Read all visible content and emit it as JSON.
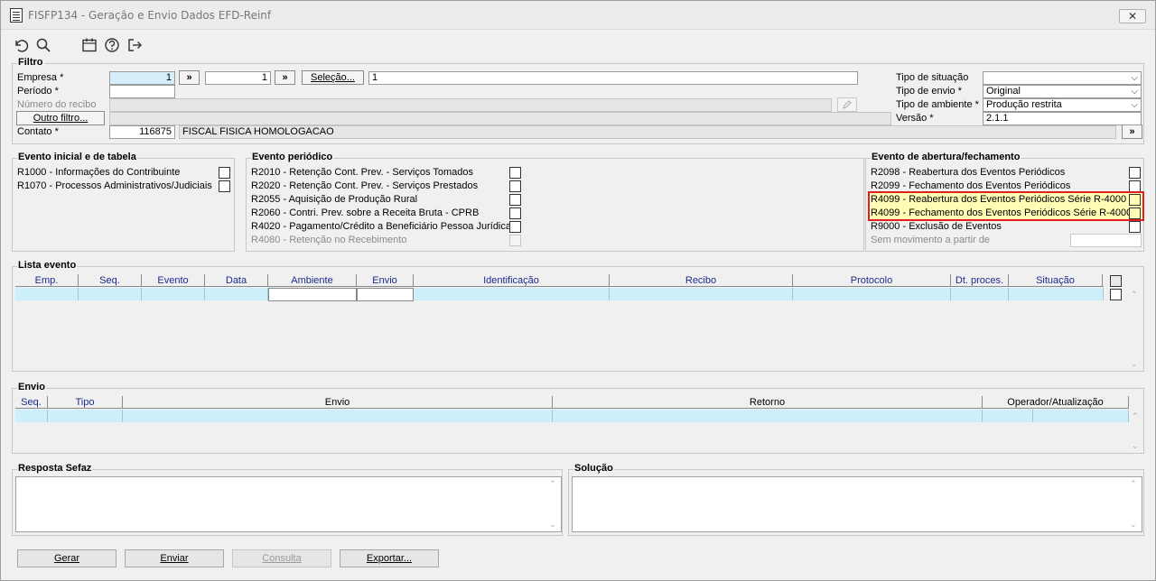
{
  "window": {
    "title": "FISFP134 - Geração e Envio Dados EFD-Reinf",
    "close": "✕"
  },
  "toolbar": {
    "icons": [
      "undo-icon",
      "search-icon",
      "calendar-icon",
      "help-icon",
      "exit-icon"
    ]
  },
  "filtro": {
    "title": "Filtro",
    "empresa_label": "Empresa *",
    "empresa_from": "1",
    "empresa_to": "1",
    "more_btn": "»",
    "selecao_btn": "Seleção...",
    "selecao_value": "1",
    "periodo_label": "Período *",
    "periodo_value": "",
    "recibo_label": "Número do recibo",
    "outro_btn": "Outro filtro...",
    "contato_label": "Contato *",
    "contato_code": "116875",
    "contato_name": "FISCAL FISICA HOMOLOGACAO",
    "tipo_situacao_label": "Tipo de situação",
    "tipo_situacao_value": "",
    "tipo_envio_label": "Tipo de envio *",
    "tipo_envio_value": "Original",
    "tipo_ambiente_label": "Tipo de ambiente *",
    "tipo_ambiente_value": "Produção restrita",
    "versao_label": "Versão *",
    "versao_value": "2.1.1"
  },
  "evento_inicial": {
    "title": "Evento inicial e de tabela",
    "items": [
      {
        "label": "R1000 - Informações do Contribuinte"
      },
      {
        "label": "R1070 - Processos Administrativos/Judiciais"
      }
    ]
  },
  "evento_periodico": {
    "title": "Evento periódico",
    "items": [
      {
        "label": "R2010 - Retenção Cont. Prev. - Serviços Tomados"
      },
      {
        "label": "R2020 - Retenção Cont. Prev. - Serviços Prestados"
      },
      {
        "label": "R2055 - Aquisição de Produção Rural"
      },
      {
        "label": "R2060 - Contri. Prev. sobre a Receita Bruta - CPRB"
      },
      {
        "label": "R4020 - Pagamento/Crédito a Beneficiário Pessoa Jurídica"
      },
      {
        "label": "R4080 - Retenção no Recebimento"
      }
    ]
  },
  "evento_abertura": {
    "title": "Evento de abertura/fechamento",
    "items": [
      {
        "label": "R2098 - Reabertura dos Eventos Periódicos"
      },
      {
        "label": "R2099 - Fechamento dos Eventos Periódicos"
      },
      {
        "label": "R4099 - Reabertura dos Eventos Periódicos Série R-4000"
      },
      {
        "label": "R4099 - Fechamento dos Eventos Periódicos Série R-4000"
      },
      {
        "label": "R9000 - Exclusão de Eventos"
      }
    ],
    "sem_movimento_label": "Sem movimento a partir de",
    "sem_movimento_value": ""
  },
  "lista_evento": {
    "title": "Lista evento",
    "columns": [
      "Emp.",
      "Seq.",
      "Evento",
      "Data",
      "Ambiente",
      "Envio",
      "Identificação",
      "Recibo",
      "Protocolo",
      "Dt. proces.",
      "Situação"
    ]
  },
  "envio": {
    "title": "Envio",
    "columns": [
      "Seq.",
      "Tipo",
      "Envio",
      "Retorno",
      "Operador/Atualização"
    ]
  },
  "resposta": {
    "title": "Resposta Sefaz"
  },
  "solucao": {
    "title": "Solução"
  },
  "buttons": {
    "gerar": "Gerar",
    "enviar": "Enviar",
    "consulta": "Consulta",
    "exportar": "Exportar..."
  },
  "colors": {
    "highlight": "#fffcb5",
    "highlight_border": "#e02020",
    "grid_row": "#cdeefb",
    "header_text": "#1a2a8a"
  }
}
